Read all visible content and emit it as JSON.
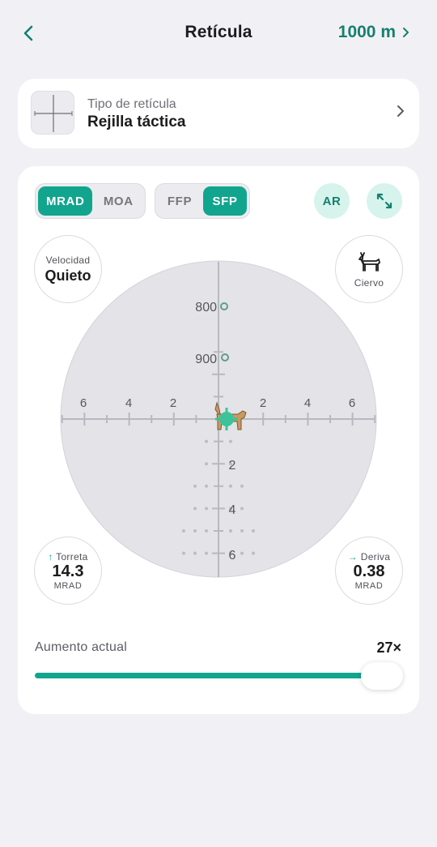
{
  "header": {
    "title": "Retícula",
    "distance": "1000 m",
    "back_icon": "chevron-left-icon",
    "distance_icon": "chevron-right-icon",
    "accent_color": "#167f6f"
  },
  "reticle_type": {
    "label": "Tipo de retícula",
    "value": "Rejilla táctica"
  },
  "units_toggle": {
    "options": [
      "MRAD",
      "MOA"
    ],
    "selected": "MRAD"
  },
  "plane_toggle": {
    "options": [
      "FFP",
      "SFP"
    ],
    "selected": "SFP"
  },
  "ar_button": "AR",
  "expand_icon": "expand-icon",
  "velocity": {
    "label": "Velocidad",
    "value": "Quieto"
  },
  "target": {
    "label": "Ciervo",
    "icon": "deer-icon"
  },
  "reticle": {
    "range_marks": [
      "800",
      "900"
    ],
    "horizontal_labels": [
      "6",
      "4",
      "2",
      "2",
      "4",
      "6"
    ],
    "vertical_labels": [
      "2",
      "4",
      "6"
    ],
    "background_color": "#e3e3e8",
    "impact_color": "#3cc39a"
  },
  "turret": {
    "label": "Torreta",
    "value": "14.3",
    "unit": "MRAD"
  },
  "drift": {
    "label": "Deriva",
    "value": "0.38",
    "unit": "MRAD"
  },
  "zoom": {
    "label": "Aumento actual",
    "value": "27×",
    "slider_fraction": 1.0
  },
  "colors": {
    "accent": "#12a58e",
    "accent_light": "#d6f3ec",
    "background": "#f1f1f5"
  }
}
